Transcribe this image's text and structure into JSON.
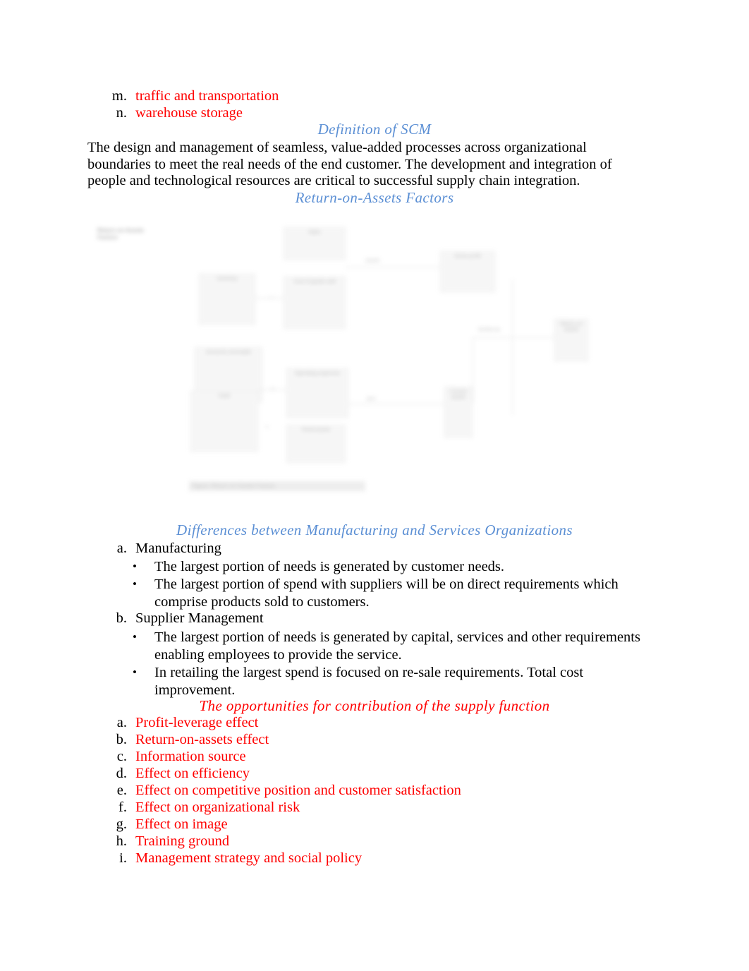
{
  "document": {
    "top_list": {
      "items": [
        {
          "marker": "m.",
          "text": "traffic and transportation",
          "color": "#FF0000"
        },
        {
          "marker": "n.",
          "text": "warehouse storage",
          "color": "#FF0000"
        }
      ]
    },
    "headings": {
      "definition_scm": "Definition of SCM",
      "roa_factors": "Return-on-Assets Factors",
      "differences": "Differences between Manufacturing and Services Organizations",
      "opportunities": "The opportunities for contribution of the supply function"
    },
    "scm_paragraph": "The design and management of seamless, value-added processes across organizational boundaries to meet the real needs of the end customer. The development and integration of people and technological resources are critical to successful supply chain integration.",
    "differences_list": [
      {
        "marker": "a.",
        "text": "Manufacturing",
        "bullets": [
          "The largest portion of needs is generated by customer needs.",
          "The largest portion of spend with suppliers will be on direct requirements which comprise products sold to customers."
        ]
      },
      {
        "marker": "b.",
        "text": "Supplier Management",
        "bullets": [
          "The largest portion of needs is generated by capital, services and other requirements enabling employees to provide the service.",
          "In retailing the largest spend is focused on re-sale requirements. Total cost improvement."
        ]
      }
    ],
    "opportunities_list": [
      {
        "marker": "a.",
        "text": "Profit-leverage effect"
      },
      {
        "marker": "b.",
        "text": "Return-on-assets effect"
      },
      {
        "marker": "c.",
        "text": "Information source"
      },
      {
        "marker": "d.",
        "text": "Effect on efficiency"
      },
      {
        "marker": "e.",
        "text": "Effect on competitive position and customer satisfaction"
      },
      {
        "marker": "f.",
        "text": "Effect on organizational risk"
      },
      {
        "marker": "g.",
        "text": "Effect on image"
      },
      {
        "marker": "h.",
        "text": "Training ground"
      },
      {
        "marker": "i.",
        "text": "Management strategy and social policy"
      }
    ],
    "bullet_glyph": "•",
    "colors": {
      "heading_blue": "#5B8FD4",
      "heading_red": "#FF0000",
      "body_black": "#000000"
    },
    "roa_diagram": {
      "alt": "Return-on-Assets Factors flowchart (low resolution / blurred)",
      "title_block": "Return on Assets Factors",
      "caption": "Figure: Return-on-Assets Factors",
      "boxes": [
        {
          "id": "b1",
          "label": "Sales"
        },
        {
          "id": "b2",
          "label": "Cost of goods sold"
        },
        {
          "id": "b3",
          "label": "Gross profit"
        },
        {
          "id": "b4",
          "label": "Operating expenses"
        },
        {
          "id": "b5",
          "label": "Net income"
        },
        {
          "id": "b6",
          "label": "Inventory"
        },
        {
          "id": "b7",
          "label": "Accounts receivable"
        },
        {
          "id": "b8",
          "label": "Cash"
        },
        {
          "id": "b9",
          "label": "Current assets"
        },
        {
          "id": "b10",
          "label": "Fixed assets"
        },
        {
          "id": "b11",
          "label": "Total assets"
        },
        {
          "id": "b12",
          "label": "Return on assets"
        }
      ],
      "operators": [
        {
          "id": "op1",
          "symbol": "−"
        },
        {
          "id": "op2",
          "symbol": "+"
        },
        {
          "id": "op3",
          "symbol": "+"
        }
      ],
      "edge_labels": [
        {
          "id": "e1",
          "text": "divided by"
        },
        {
          "id": "e2",
          "text": "equals"
        },
        {
          "id": "e3",
          "text": "plus"
        }
      ]
    }
  }
}
